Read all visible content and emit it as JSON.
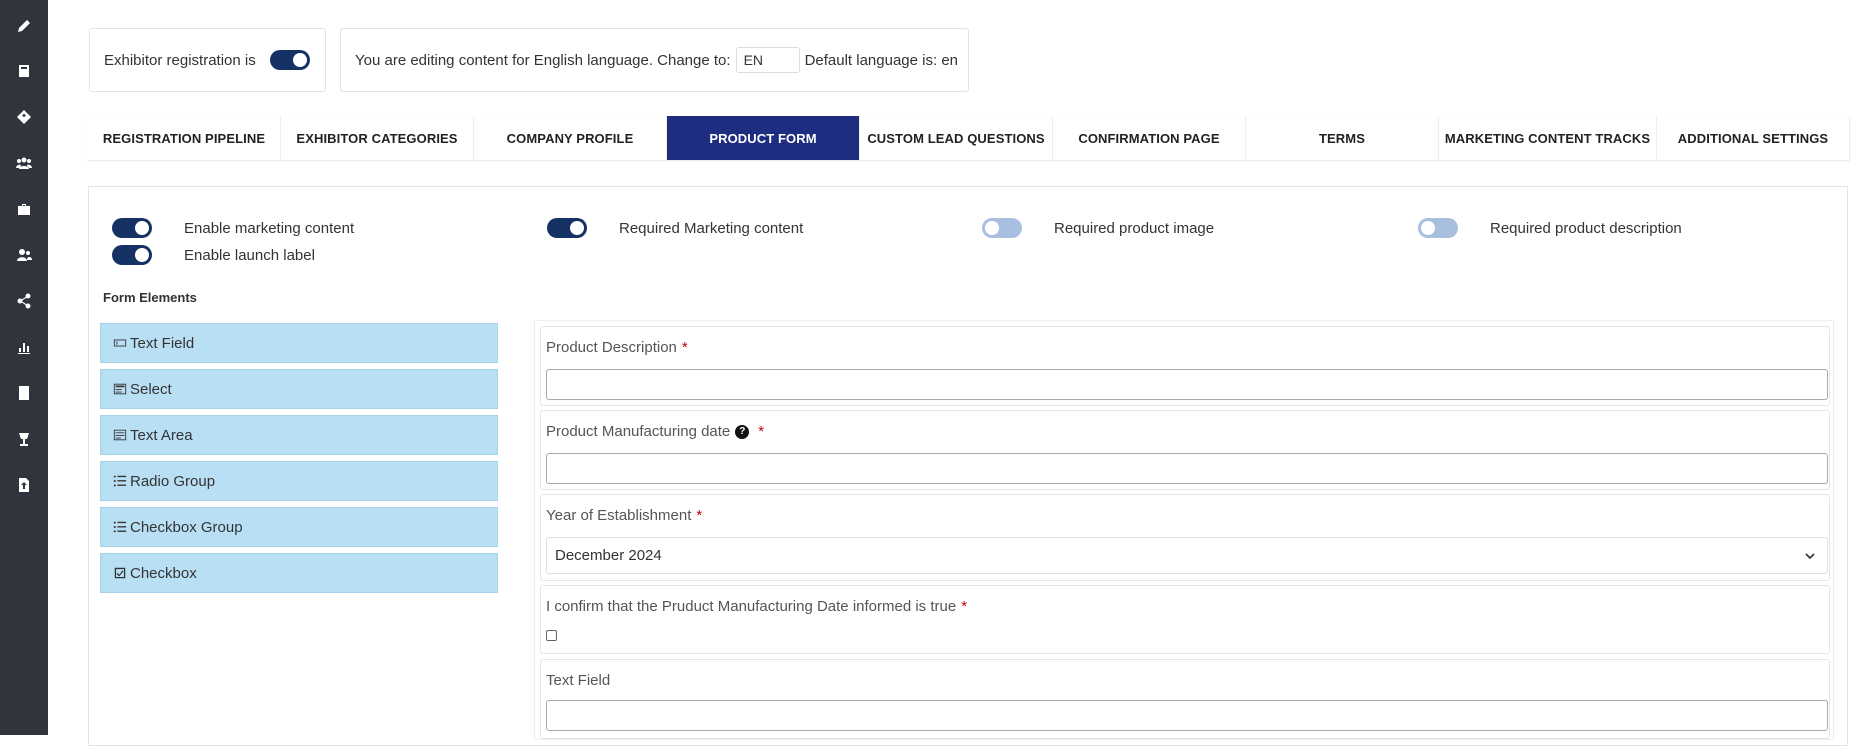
{
  "sidebar": {
    "icons": [
      "pencil-icon",
      "book-icon",
      "tag-icon",
      "group-icon",
      "briefcase-icon",
      "users-icon",
      "share-icon",
      "bar-chart-icon",
      "document-icon",
      "lamp-icon",
      "file-upload-icon"
    ]
  },
  "registration": {
    "label": "Exhibitor registration is",
    "enabled": true
  },
  "language": {
    "editing_text": "You are editing content for English language. Change to:",
    "code_value": "EN",
    "default_text": "Default language is: en"
  },
  "tabs": [
    {
      "label": "REGISTRATION PIPELINE"
    },
    {
      "label": "EXHIBITOR CATEGORIES"
    },
    {
      "label": "COMPANY PROFILE"
    },
    {
      "label": "PRODUCT FORM"
    },
    {
      "label": "CUSTOM LEAD QUESTIONS"
    },
    {
      "label": "CONFIRMATION PAGE"
    },
    {
      "label": "TERMS"
    },
    {
      "label": "MARKETING CONTENT TRACKS"
    },
    {
      "label": "ADDITIONAL SETTINGS"
    }
  ],
  "active_tab": "PRODUCT FORM",
  "options": [
    {
      "label": "Enable marketing content",
      "enabled": true
    },
    {
      "label": "Enable launch label",
      "enabled": true
    },
    {
      "label": "Required Marketing content",
      "enabled": true
    },
    {
      "label": "Required product image",
      "enabled": false
    },
    {
      "label": "Required product description",
      "enabled": false
    }
  ],
  "form_elements": {
    "title": "Form Elements",
    "items": [
      {
        "label": "Text Field",
        "icon": "text-field-icon"
      },
      {
        "label": "Select",
        "icon": "select-icon"
      },
      {
        "label": "Text Area",
        "icon": "text-area-icon"
      },
      {
        "label": "Radio Group",
        "icon": "radio-group-icon"
      },
      {
        "label": "Checkbox Group",
        "icon": "checkbox-group-icon"
      },
      {
        "label": "Checkbox",
        "icon": "checkbox-icon"
      }
    ]
  },
  "form_fields": [
    {
      "label": "Product Description",
      "required": "*",
      "type": "text"
    },
    {
      "label": "Product Manufacturing date",
      "help": "?",
      "required": "*",
      "type": "text"
    },
    {
      "label": "Year of Establishment",
      "required": "*",
      "type": "select",
      "value": "December 2024"
    },
    {
      "label": "I confirm that the Pruduct Manufacturing Date informed is true",
      "required": "*",
      "type": "checkbox"
    },
    {
      "label": "Text Field",
      "type": "text"
    }
  ],
  "colors": {
    "sidebar": "#30343d",
    "active_tab": "#1e2d80",
    "toggle_on": "#163264",
    "toggle_off": "#a9bfe0",
    "element_bg": "#b9dff5",
    "required": "#cc0000"
  }
}
